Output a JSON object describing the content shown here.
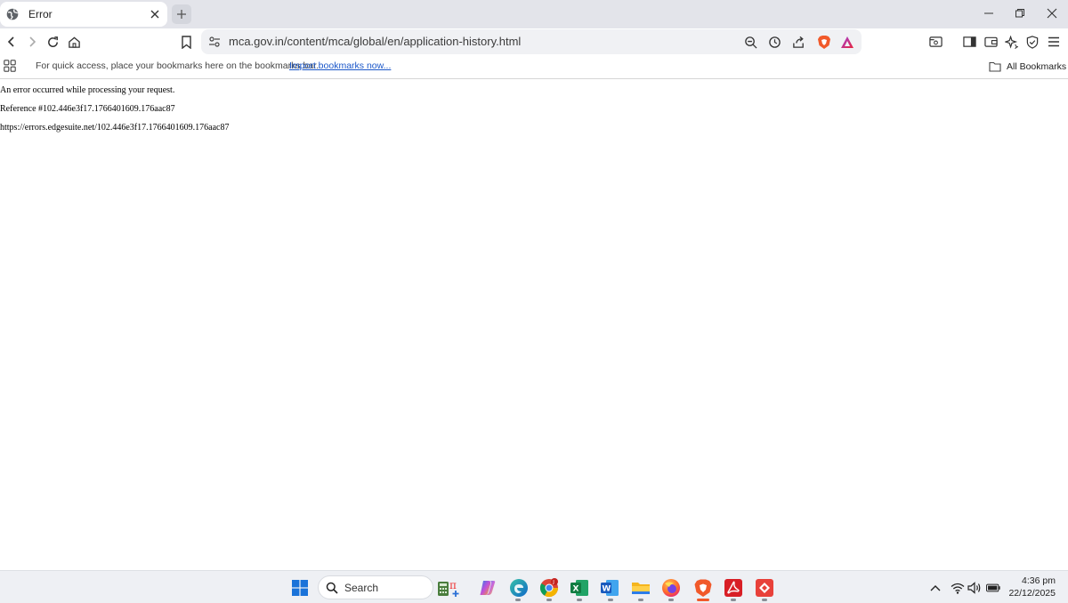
{
  "tab": {
    "title": "Error",
    "favicon": "globe-icon"
  },
  "omnibox": {
    "url": "mca.gov.in/content/mca/global/en/application-history.html"
  },
  "bookmarks_bar": {
    "hint": "For quick access, place your bookmarks here on the bookmarks bar.",
    "import_link": "Import bookmarks now...",
    "all_bookmarks": "All Bookmarks"
  },
  "page": {
    "line1": "An error occurred while processing your request.",
    "line2": "Reference #102.446e3f17.1766401609.176aac87",
    "line3": "https://errors.edgesuite.net/102.446e3f17.1766401609.176aac87"
  },
  "taskbar": {
    "search_label": "Search",
    "time": "4:36 pm",
    "date": "22/12/2025"
  },
  "colors": {
    "brave": "#f1592a",
    "link": "#1b57c9",
    "taskbar_bg": "#eef0f4"
  }
}
